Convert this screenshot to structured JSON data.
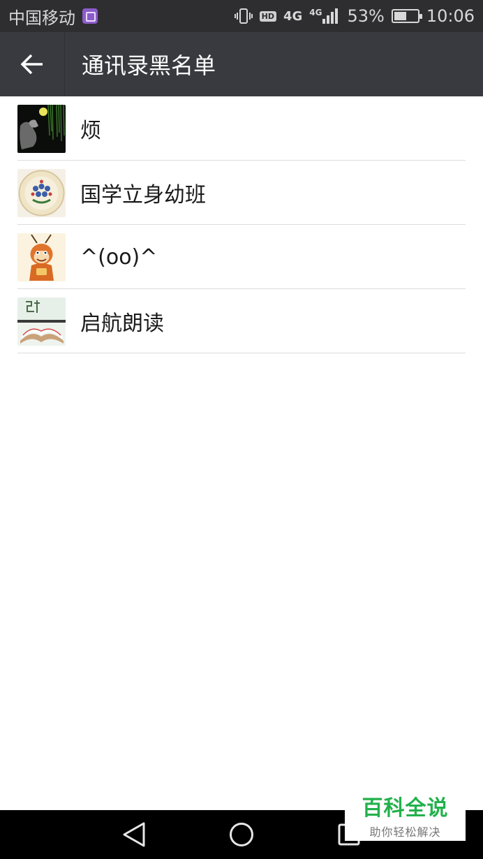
{
  "status_bar": {
    "carrier": "中国移动",
    "gallery_icon": "gallery-notification-icon",
    "vibrate_icon": "vibrate-icon",
    "hd_label": "HD",
    "network_1": "4G",
    "network_2": "4G",
    "battery_percent": "53%",
    "battery_level": 0.53,
    "time": "10:06"
  },
  "app_bar": {
    "back_icon": "arrow-left-icon",
    "title": "通讯录黑名单"
  },
  "list": {
    "items": [
      {
        "name": "烦",
        "avatar": "night-willow-avatar"
      },
      {
        "name": "国学立身幼班",
        "avatar": "flower-emblem-avatar"
      },
      {
        "name": "^(oo)^",
        "avatar": "cartoon-monkey-avatar"
      },
      {
        "name": "启航朗读",
        "avatar": "open-book-avatar"
      }
    ]
  },
  "nav_bar": {
    "back": "triangle-back-icon",
    "home": "circle-home-icon",
    "recents": "square-recents-icon"
  },
  "watermark": {
    "title": "百科全说",
    "subtitle": "助你轻松解决"
  },
  "colors": {
    "status_bg": "#2e2e30",
    "app_bar_bg": "#393a3f",
    "divider": "#dcdcdc",
    "watermark_green": "#22b14c"
  }
}
